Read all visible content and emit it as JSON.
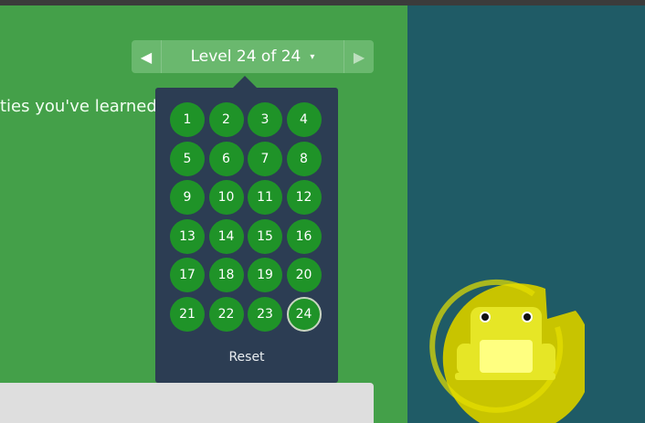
{
  "instructions": {
    "text": "ties you've learned:"
  },
  "level_nav": {
    "prev_icon": "chevron-left-icon",
    "next_icon": "chevron-right-icon",
    "label": "Level 24 of 24",
    "caret": "▾"
  },
  "level_popup": {
    "levels": [
      "1",
      "2",
      "3",
      "4",
      "5",
      "6",
      "7",
      "8",
      "9",
      "10",
      "11",
      "12",
      "13",
      "14",
      "15",
      "16",
      "17",
      "18",
      "19",
      "20",
      "21",
      "22",
      "23",
      "24"
    ],
    "current_level": "24",
    "reset_label": "Reset"
  },
  "colors": {
    "left_bg": "#44a049",
    "right_bg": "#1f5b66",
    "popup_bg": "#2c3d53",
    "level_circle": "#1f9328",
    "lilypad": "#c8c400",
    "frog": "#e6e626"
  }
}
